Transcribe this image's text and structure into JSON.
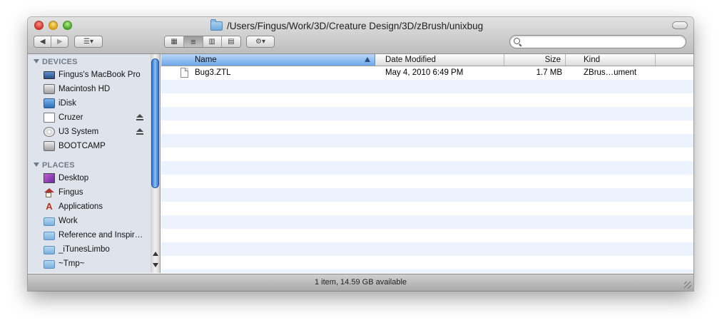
{
  "window": {
    "title": "/Users/Fingus/Work/3D/Creature Design/3D/zBrush/unixbug"
  },
  "toolbar": {
    "back_glyph": "◀",
    "forward_glyph": "▶",
    "arrange_glyph": "☰▾",
    "view_icon_glyph": "▦",
    "view_list_glyph": "≡",
    "view_column_glyph": "▥",
    "view_coverflow_glyph": "▤",
    "action_glyph": "⚙▾",
    "search_placeholder": ""
  },
  "sidebar": {
    "devices_label": "DEVICES",
    "devices": [
      {
        "label": "Fingus's MacBook Pro",
        "icon": "macbook-icon"
      },
      {
        "label": "Macintosh HD",
        "icon": "hard-drive-icon"
      },
      {
        "label": "iDisk",
        "icon": "idisk-icon"
      },
      {
        "label": "Cruzer",
        "icon": "usb-drive-icon"
      },
      {
        "label": "U3 System",
        "icon": "cd-icon"
      },
      {
        "label": "BOOTCAMP",
        "icon": "hard-drive-icon"
      }
    ],
    "places_label": "PLACES",
    "places": [
      {
        "label": "Desktop",
        "icon": "desktop-icon"
      },
      {
        "label": "Fingus",
        "icon": "home-icon"
      },
      {
        "label": "Applications",
        "icon": "applications-icon"
      },
      {
        "label": "Work",
        "icon": "folder-icon"
      },
      {
        "label": "Reference and Inspir…",
        "icon": "folder-icon"
      },
      {
        "label": "_iTunesLimbo",
        "icon": "folder-icon"
      },
      {
        "label": "~Tmp~",
        "icon": "folder-icon"
      }
    ]
  },
  "list": {
    "columns": {
      "name": "Name",
      "date": "Date Modified",
      "size": "Size",
      "kind": "Kind"
    },
    "rows": [
      {
        "name": "Bug3.ZTL",
        "date": "May 4, 2010 6:49 PM",
        "size": "1.7 MB",
        "kind": "ZBrus…ument"
      }
    ]
  },
  "status": {
    "text": "1 item, 14.59 GB available"
  }
}
